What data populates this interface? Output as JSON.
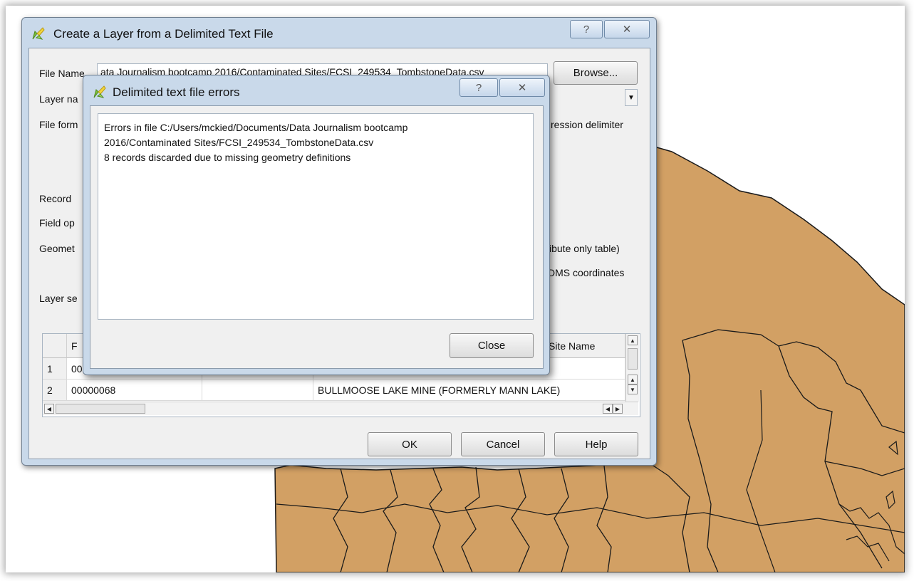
{
  "main_dialog": {
    "title": "Create a Layer from a Delimited Text File",
    "help_glyph": "?",
    "close_glyph": "✕",
    "file_name_label": "File Name",
    "file_name_value": "ata Journalism bootcamp 2016/Contaminated Sites/FCSI_249534_TombstoneData.csv",
    "browse_label": "Browse...",
    "layer_name_label": "Layer na",
    "file_format_label": "File form",
    "regex_delimiter_label": "ression delimiter",
    "record_label": "Record",
    "field_options_label": "Field op",
    "geometry_label": "Geomet",
    "attribute_only_label": "ibute only table)",
    "dms_label": "DMS coordinates",
    "layer_settings_label": "Layer se",
    "table": {
      "headers": [
        "",
        "F",
        "",
        "Site Name"
      ],
      "rows": [
        {
          "num": "1",
          "c1": "00",
          "c2": "",
          "c3": ""
        },
        {
          "num": "2",
          "c1": "00000068",
          "c2": "",
          "c3": "BULLMOOSE LAKE MINE (FORMERLY MANN LAKE)"
        }
      ]
    },
    "ok_label": "OK",
    "cancel_label": "Cancel",
    "help_label": "Help"
  },
  "error_dialog": {
    "title": "Delimited text file errors",
    "help_glyph": "?",
    "close_glyph": "✕",
    "lines": [
      "Errors in file C:/Users/mckied/Documents/Data Journalism bootcamp",
      "2016/Contaminated Sites/FCSI_249534_TombstoneData.csv",
      "8 records discarded due to missing geometry definitions"
    ],
    "close_label": "Close"
  },
  "colors": {
    "map_fill": "#d2a064",
    "map_border": "#1a1a1a",
    "dialog_frame": "#c9d9ea"
  }
}
